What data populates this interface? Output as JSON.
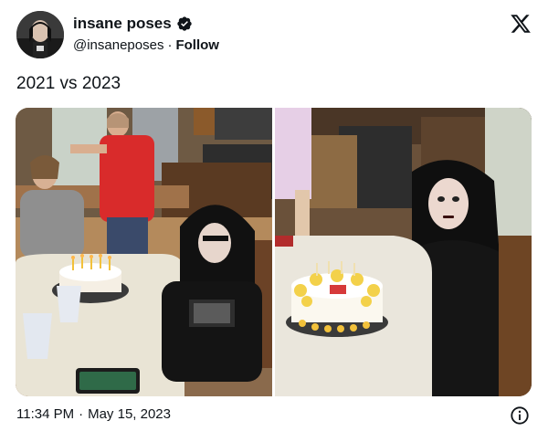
{
  "author": {
    "display_name": "insane poses",
    "handle": "@insaneposes",
    "separator": "·",
    "follow_label": "Follow",
    "verified": true,
    "avatar_icon": "profile-avatar-icon"
  },
  "brand": {
    "logo_icon": "x-logo-icon"
  },
  "tweet": {
    "text": "2021 vs 2023"
  },
  "media": {
    "items": [
      {
        "id": "photo-2021",
        "icon": "birthday-photo-left"
      },
      {
        "id": "photo-2023",
        "icon": "birthday-photo-right"
      }
    ]
  },
  "footer": {
    "time": "11:34 PM",
    "separator": "·",
    "date": "May 15, 2023",
    "info_icon": "info-icon"
  },
  "colors": {
    "text": "#0f1419",
    "verified_badge": "#0f1419",
    "background": "#ffffff"
  }
}
